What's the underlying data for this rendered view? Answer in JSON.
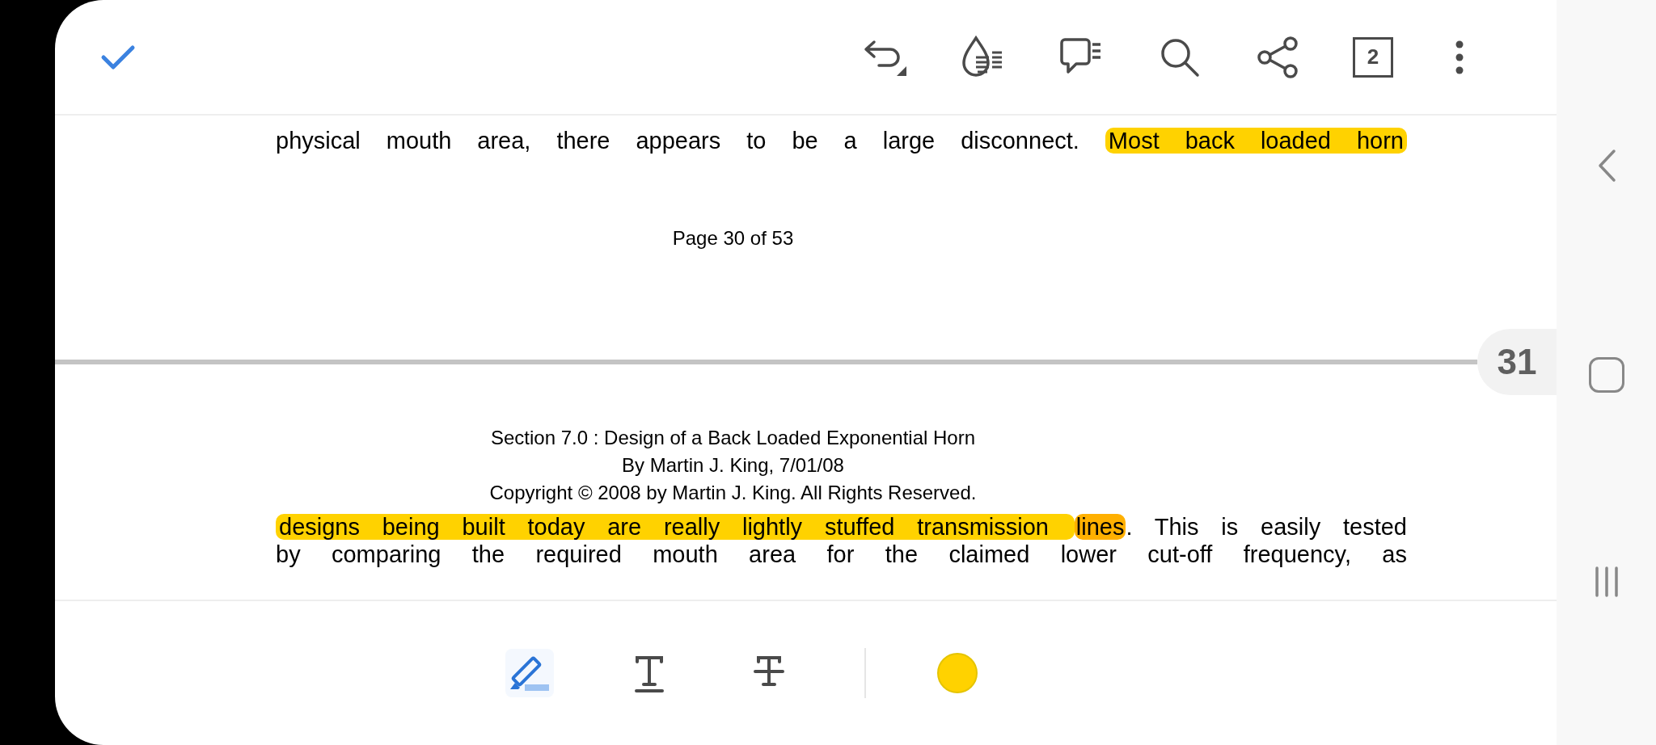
{
  "top_toolbar": {
    "tab_count": "2"
  },
  "page_30": {
    "lines": [
      {
        "segments": [
          {
            "text": "physical mouth area, there appears to be a large disconnect. ",
            "kind": "plain"
          },
          {
            "text": "Most back loaded horn",
            "kind": "highlight"
          }
        ]
      }
    ],
    "footer": "Page 30 of 53"
  },
  "page_indicator": "31",
  "page_31": {
    "header": [
      "Section 7.0 : Design of a Back Loaded Exponential Horn",
      "By Martin J. King, 7/01/08",
      "Copyright © 2008 by Martin J. King. All Rights Reserved."
    ],
    "lines": [
      {
        "segments": [
          {
            "text": "designs being built today are really lightly stuffed transmission ",
            "kind": "highlight"
          },
          {
            "text": "lines",
            "kind": "double_highlight"
          },
          {
            "text": ". This is easily tested",
            "kind": "plain"
          }
        ]
      },
      {
        "segments": [
          {
            "text": "by comparing the required mouth area for the claimed lower cut-off frequency, as",
            "kind": "plain"
          }
        ]
      }
    ]
  },
  "annotation_toolbar": {
    "tools": [
      {
        "kind": "highlight",
        "selected": true
      },
      {
        "kind": "underline",
        "selected": false
      },
      {
        "kind": "strikethrough",
        "selected": false
      }
    ],
    "color": "#ffd200"
  }
}
